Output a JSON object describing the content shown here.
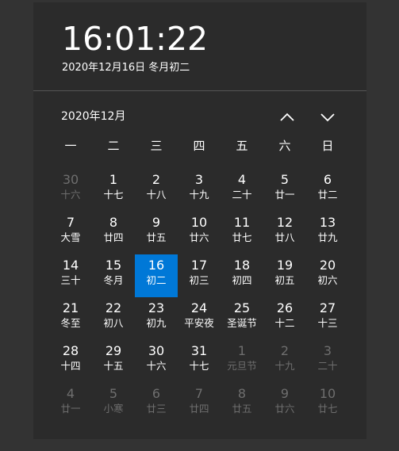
{
  "clock": {
    "time": "16:01:22",
    "date_line": "2020年12月16日 冬月初二"
  },
  "calendar": {
    "month_title": "2020年12月",
    "nav": {
      "up_icon": "chevron-up-icon",
      "down_icon": "chevron-down-icon"
    },
    "weekdays": [
      "一",
      "二",
      "三",
      "四",
      "五",
      "六",
      "日"
    ],
    "accent_color": "#0078d7",
    "days": [
      {
        "num": "30",
        "lunar": "十六",
        "dim": true
      },
      {
        "num": "1",
        "lunar": "十七",
        "dim": false
      },
      {
        "num": "2",
        "lunar": "十八",
        "dim": false
      },
      {
        "num": "3",
        "lunar": "十九",
        "dim": false
      },
      {
        "num": "4",
        "lunar": "二十",
        "dim": false
      },
      {
        "num": "5",
        "lunar": "廿一",
        "dim": false
      },
      {
        "num": "6",
        "lunar": "廿二",
        "dim": false
      },
      {
        "num": "7",
        "lunar": "大雪",
        "dim": false
      },
      {
        "num": "8",
        "lunar": "廿四",
        "dim": false
      },
      {
        "num": "9",
        "lunar": "廿五",
        "dim": false
      },
      {
        "num": "10",
        "lunar": "廿六",
        "dim": false
      },
      {
        "num": "11",
        "lunar": "廿七",
        "dim": false
      },
      {
        "num": "12",
        "lunar": "廿八",
        "dim": false
      },
      {
        "num": "13",
        "lunar": "廿九",
        "dim": false
      },
      {
        "num": "14",
        "lunar": "三十",
        "dim": false
      },
      {
        "num": "15",
        "lunar": "冬月",
        "dim": false
      },
      {
        "num": "16",
        "lunar": "初二",
        "dim": false,
        "today": true
      },
      {
        "num": "17",
        "lunar": "初三",
        "dim": false
      },
      {
        "num": "18",
        "lunar": "初四",
        "dim": false
      },
      {
        "num": "19",
        "lunar": "初五",
        "dim": false
      },
      {
        "num": "20",
        "lunar": "初六",
        "dim": false
      },
      {
        "num": "21",
        "lunar": "冬至",
        "dim": false
      },
      {
        "num": "22",
        "lunar": "初八",
        "dim": false
      },
      {
        "num": "23",
        "lunar": "初九",
        "dim": false
      },
      {
        "num": "24",
        "lunar": "平安夜",
        "dim": false
      },
      {
        "num": "25",
        "lunar": "圣诞节",
        "dim": false
      },
      {
        "num": "26",
        "lunar": "十二",
        "dim": false
      },
      {
        "num": "27",
        "lunar": "十三",
        "dim": false
      },
      {
        "num": "28",
        "lunar": "十四",
        "dim": false
      },
      {
        "num": "29",
        "lunar": "十五",
        "dim": false
      },
      {
        "num": "30",
        "lunar": "十六",
        "dim": false
      },
      {
        "num": "31",
        "lunar": "十七",
        "dim": false
      },
      {
        "num": "1",
        "lunar": "元旦节",
        "dim": true
      },
      {
        "num": "2",
        "lunar": "十九",
        "dim": true
      },
      {
        "num": "3",
        "lunar": "二十",
        "dim": true
      },
      {
        "num": "4",
        "lunar": "廿一",
        "dim": true
      },
      {
        "num": "5",
        "lunar": "小寒",
        "dim": true
      },
      {
        "num": "6",
        "lunar": "廿三",
        "dim": true
      },
      {
        "num": "7",
        "lunar": "廿四",
        "dim": true
      },
      {
        "num": "8",
        "lunar": "廿五",
        "dim": true
      },
      {
        "num": "9",
        "lunar": "廿六",
        "dim": true
      },
      {
        "num": "10",
        "lunar": "廿七",
        "dim": true
      }
    ]
  }
}
